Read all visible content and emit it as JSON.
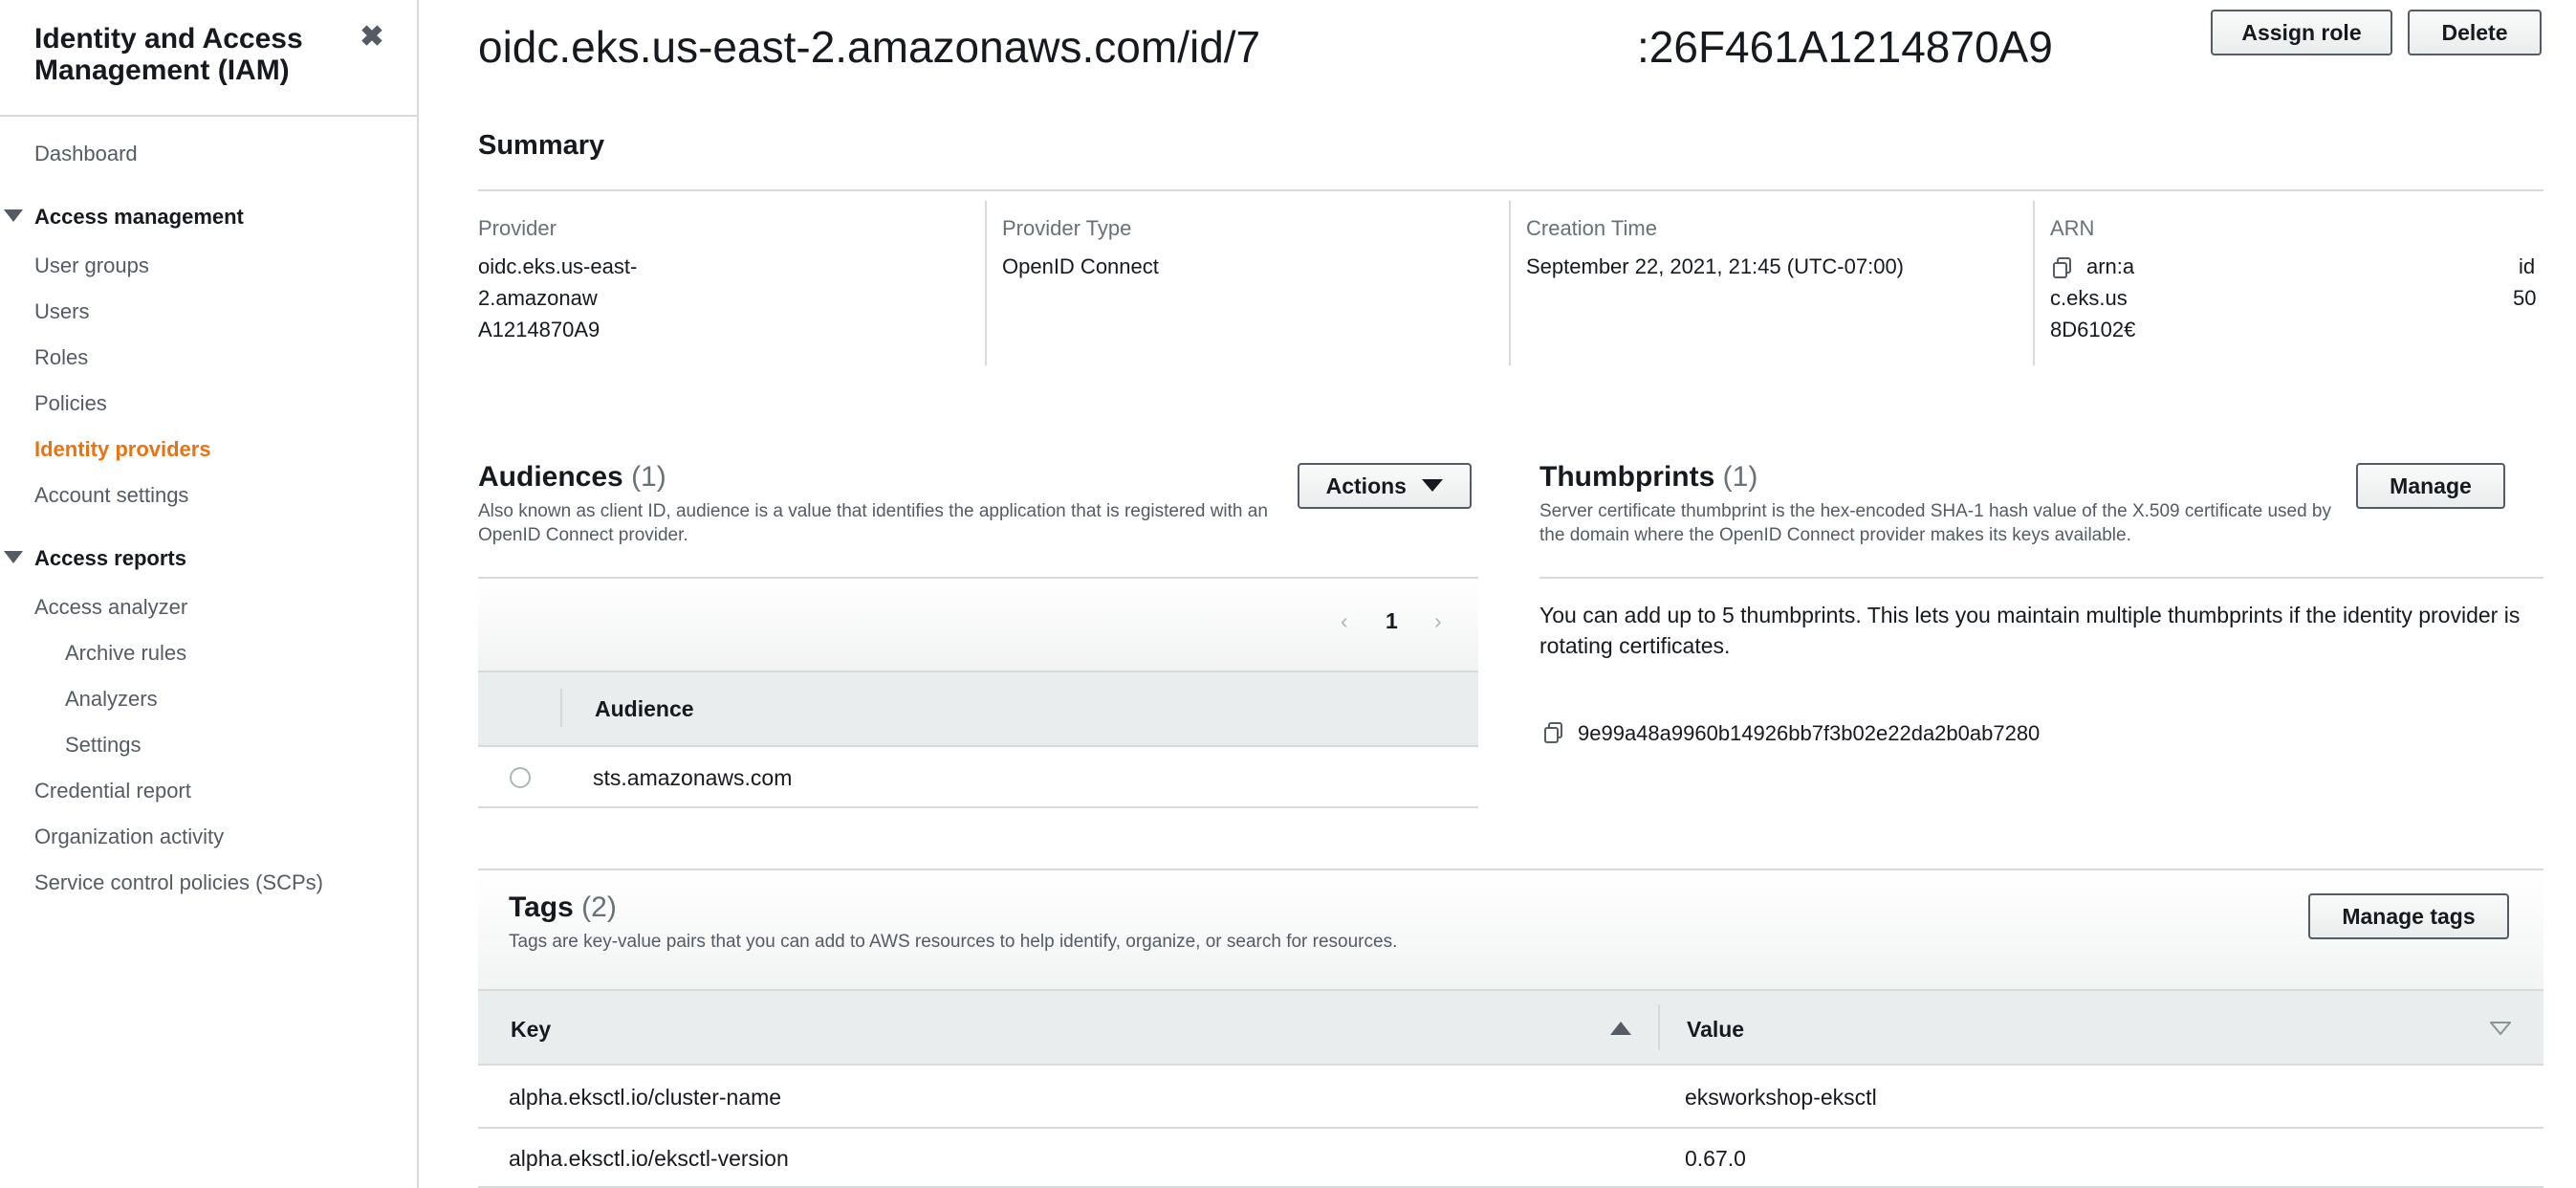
{
  "sidebar": {
    "title": "Identity and Access Management (IAM)",
    "close_glyph": "✖",
    "items": {
      "dashboard": "Dashboard",
      "access_management": "Access management",
      "user_groups": "User groups",
      "users": "Users",
      "roles": "Roles",
      "policies": "Policies",
      "identity_providers": "Identity providers",
      "account_settings": "Account settings",
      "access_reports": "Access reports",
      "access_analyzer": "Access analyzer",
      "archive_rules": "Archive rules",
      "analyzers": "Analyzers",
      "settings": "Settings",
      "credential_report": "Credential report",
      "organization_activity": "Organization activity",
      "scps": "Service control policies (SCPs)"
    },
    "active_item": "Identity providers",
    "active_color": "#ec7211"
  },
  "header": {
    "title_left": "oidc.eks.us-east-2.amazonaws.com/id/7",
    "title_right": ":26F461A1214870A9",
    "assign_role": "Assign role",
    "delete": "Delete"
  },
  "summary": {
    "title": "Summary",
    "provider_label": "Provider",
    "provider_value": [
      "oidc.eks.us-east-",
      "2.amazonaw",
      "A1214870A9"
    ],
    "type_label": "Provider Type",
    "type_value": "OpenID Connect",
    "created_label": "Creation Time",
    "created_value": "September 22, 2021, 21:45 (UTC-07:00)",
    "arn_label": "ARN",
    "arn_value": [
      "arn:a",
      "c.eks.us",
      "8D6102€"
    ],
    "arn_value_right": [
      "id",
      "50"
    ]
  },
  "audiences": {
    "title": "Audiences",
    "count": "(1)",
    "description": "Also known as client ID, audience is a value that identifies the application that is registered with an OpenID Connect provider.",
    "actions": "Actions",
    "page": "1",
    "column": "Audience",
    "rows": [
      "sts.amazonaws.com"
    ]
  },
  "thumbprints": {
    "title": "Thumbprints",
    "count": "(1)",
    "description": "Server certificate thumbprint is the hex-encoded SHA-1 hash value of the X.509 certificate used by the domain where the OpenID Connect provider makes its keys available.",
    "manage": "Manage",
    "note": "You can add up to 5 thumbprints. This lets you maintain multiple thumbprints if the identity provider is rotating certificates.",
    "value": "9e99a48a9960b14926bb7f3b02e22da2b0ab7280"
  },
  "tags": {
    "title": "Tags",
    "count": "(2)",
    "description": "Tags are key-value pairs that you can add to AWS resources to help identify, organize, or search for resources.",
    "manage": "Manage tags",
    "key_header": "Key",
    "value_header": "Value",
    "rows": [
      {
        "key": "alpha.eksctl.io/cluster-name",
        "value": "eksworkshop-eksctl"
      },
      {
        "key": "alpha.eksctl.io/eksctl-version",
        "value": "0.67.0"
      }
    ]
  }
}
